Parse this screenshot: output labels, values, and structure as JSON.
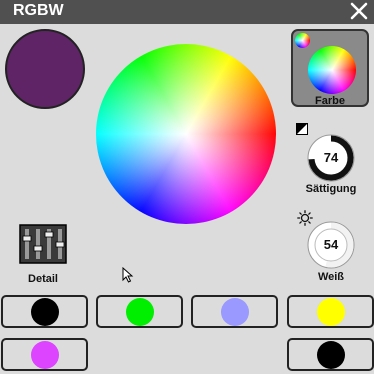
{
  "window": {
    "title": "RGBW",
    "close_icon": "close-icon"
  },
  "current_color": "#5e2466",
  "farbe": {
    "label": "Farbe"
  },
  "saettigung": {
    "label": "Sättigung",
    "value": "74",
    "fraction": 0.74
  },
  "weiss": {
    "label": "Weiß",
    "value": "54",
    "fraction": 0.54
  },
  "detail": {
    "label": "Detail"
  },
  "presets": [
    {
      "color": "#000000"
    },
    {
      "color": "#00ee00"
    },
    {
      "color": "#9999ff"
    },
    {
      "color": "#ffff00"
    },
    {
      "color": "#dd44ff"
    },
    {
      "color": "#000000"
    }
  ]
}
